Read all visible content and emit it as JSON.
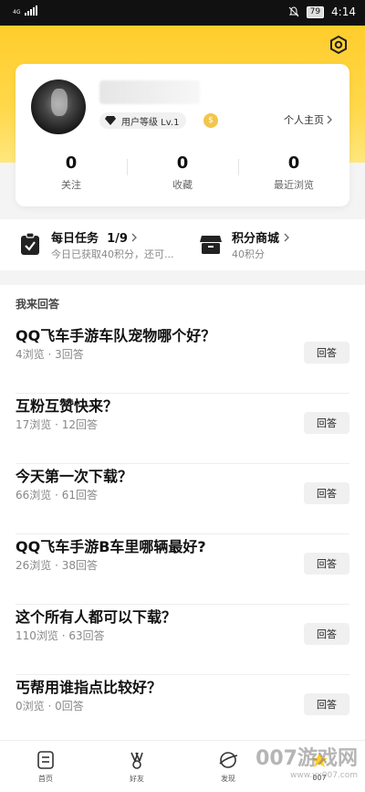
{
  "status": {
    "network": "4G",
    "battery": "79",
    "time": "4:14"
  },
  "profile": {
    "level_text": "用户等级 Lv.1",
    "homepage_label": "个人主页",
    "stats": [
      {
        "value": "0",
        "label": "关注"
      },
      {
        "value": "0",
        "label": "收藏"
      },
      {
        "value": "0",
        "label": "最近浏览"
      }
    ]
  },
  "tasks": [
    {
      "title": "每日任务",
      "progress": "1/9",
      "subtitle": "今日已获取40积分，还可..."
    },
    {
      "title": "积分商城",
      "progress": "",
      "subtitle": "40积分"
    }
  ],
  "answers": {
    "section_title": "我来回答",
    "button_label": "回答",
    "items": [
      {
        "question": "QQ飞车手游车队宠物哪个好？",
        "views": "4浏览",
        "answers": "3回答"
      },
      {
        "question": "互粉互赞快来？",
        "views": "17浏览",
        "answers": "12回答"
      },
      {
        "question": "今天第一次下载？",
        "views": "66浏览",
        "answers": "61回答"
      },
      {
        "question": "QQ飞车手游B车里哪辆最好?",
        "views": "26浏览",
        "answers": "38回答"
      },
      {
        "question": "这个所有人都可以下载？",
        "views": "110浏览",
        "answers": "63回答"
      },
      {
        "question": "丐帮用谁指点比较好？",
        "views": "0浏览",
        "answers": "0回答"
      }
    ]
  },
  "nav": [
    {
      "label": "首页",
      "icon": "home-icon"
    },
    {
      "label": "好友",
      "icon": "friends-icon"
    },
    {
      "label": "发现",
      "icon": "discover-icon"
    },
    {
      "label": "007",
      "icon": "profile-icon"
    }
  ],
  "watermark": {
    "text": "007游戏网",
    "url": "www.yx007.com"
  },
  "colors": {
    "accent": "#ffcd2c",
    "background": "#f4f4f4"
  }
}
